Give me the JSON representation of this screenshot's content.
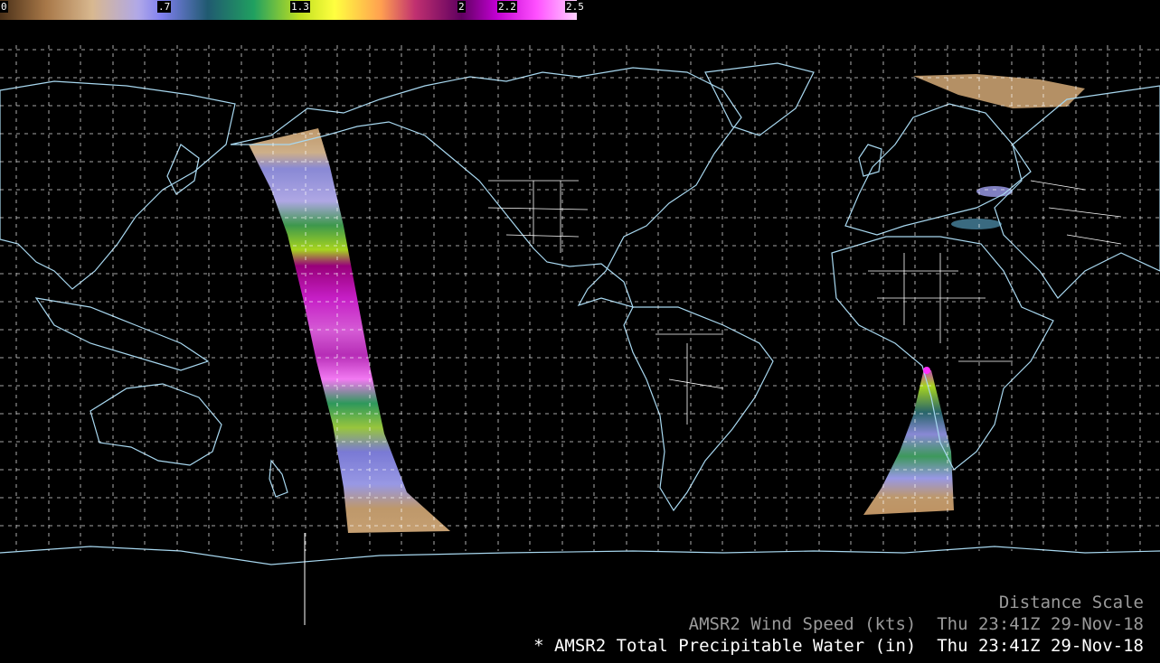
{
  "colorbar": {
    "ticks": [
      {
        "value": 0,
        "label": "0"
      },
      {
        "value": 0.7,
        "label": ".7"
      },
      {
        "value": 1.3,
        "label": "1.3"
      },
      {
        "value": 2,
        "label": "2"
      },
      {
        "value": 2.2,
        "label": "2.2"
      },
      {
        "value": 2.5,
        "label": "2.5"
      }
    ],
    "range": [
      0,
      2.5
    ],
    "colors": [
      "#6b4a2a",
      "#c8a070",
      "#e0c8a8",
      "#b8b0e8",
      "#8080f0",
      "#2a6a70",
      "#20a060",
      "#b0e020",
      "#ffff40",
      "#ffb040",
      "#d04070",
      "#900060",
      "#b000c0",
      "#ff40ff",
      "#ffc0ff"
    ]
  },
  "map": {
    "projection": "cylindrical equidistant",
    "grid": true,
    "coast_color": "#a8d8f0",
    "border_color": "#ffffff",
    "grid_color": "#ffffff"
  },
  "legend": {
    "distance_scale": "Distance Scale",
    "wind_line": "AMSR2 Wind Speed (kts)  Thu 23:41Z 29-Nov-18",
    "tpw_line": "* AMSR2 Total Precipitable Water (in)  Thu 23:41Z 29-Nov-18"
  }
}
